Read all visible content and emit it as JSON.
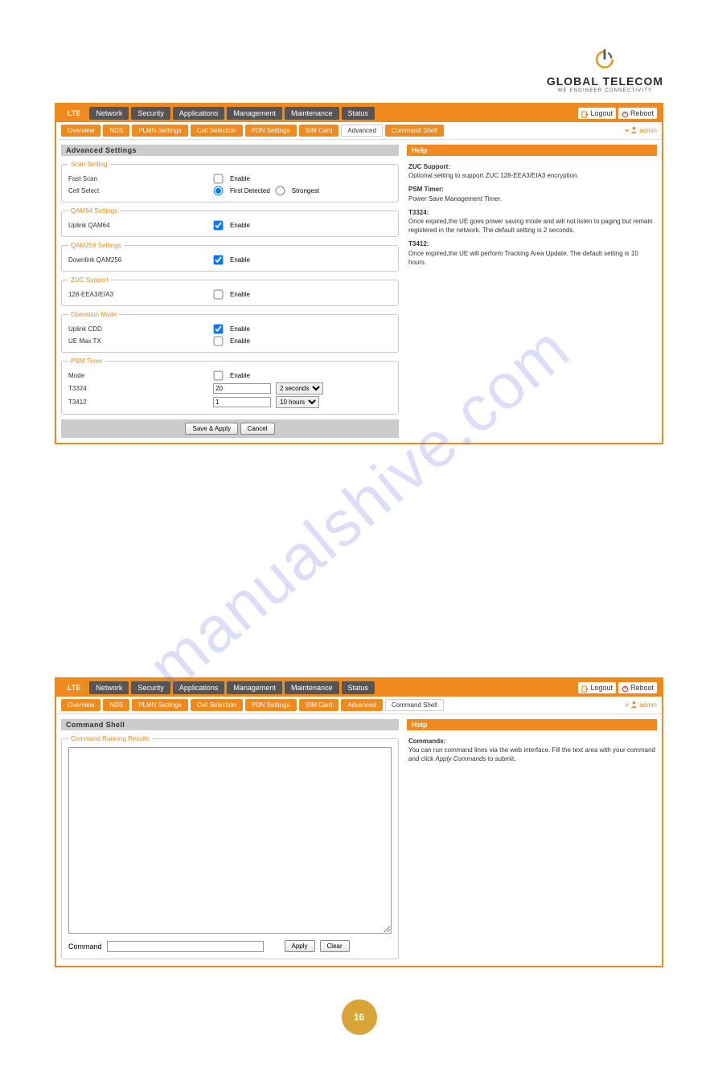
{
  "brand": {
    "name": "GLOBAL TELECOM",
    "tag": "WE ENGINEER CONNECTIVITY"
  },
  "watermark": "manualshive.com",
  "page_number": "16",
  "common": {
    "logout": "Logout",
    "reboot": "Reboot",
    "user": "admin",
    "plus": "+",
    "enable": "Enable",
    "first_detected": "First Detected",
    "strongest": "Strongest",
    "save_apply": "Save & Apply",
    "cancel": "Cancel",
    "apply": "Apply",
    "clear": "Clear"
  },
  "main_tabs": {
    "lte": "LTE",
    "network": "Network",
    "security": "Security",
    "applications": "Applications",
    "management": "Management",
    "maintenance": "Maintenance",
    "status": "Status"
  },
  "sub_tabs": {
    "overview": "Overview",
    "nds": "NDS",
    "plmn": "PLMN Settings",
    "cell": "Cell Selection",
    "pdn": "PDN Settings",
    "sim": "SIM Card",
    "advanced": "Advanced",
    "cmd": "Command Shell"
  },
  "panel1": {
    "title": "Advanced Settings",
    "help_title": "Help",
    "scan_legend": "Scan Setting",
    "fast_scan": "Fast Scan",
    "cell_select": "Cell Select",
    "qam64_legend": "QAM64 Settings",
    "uplink_qam64": "Uplink QAM64",
    "qam256_legend": "QAM256 Settings",
    "downlink_qam256": "Downlink QAM256",
    "zuc_legend": "ZUC Support",
    "zuc_label": "128-EEA3/EIA3",
    "op_legend": "Operation Mode",
    "uplink_cdd": "Uplink CDD",
    "ue_max_tx": "UE Max TX",
    "psm_legend": "PSM Timer",
    "mode": "Mode",
    "t3324": "T3324",
    "t3412": "T3412",
    "t3324_val": "20",
    "t3324_unit": "2 seconds",
    "t3412_val": "1",
    "t3412_unit": "10 hours",
    "help": {
      "zuc_h": "ZUC Support:",
      "zuc_t": "Optional setting to support ZUC 128-EEA3/EIA3 encryption.",
      "psm_h": "PSM Timer:",
      "psm_t": "Power Save Management Timer.",
      "t3324_h": "T3324:",
      "t3324_t": "Once expired,the UE goes power saving mode and will not listen to paging but remain registered in the network. The default setting is 2 seconds.",
      "t3412_h": "T3412:",
      "t3412_t": "Once expired,the UE will perform Tracking Area Update. The default setting is 10 hours."
    }
  },
  "panel2": {
    "title": "Command Shell",
    "help_title": "Help",
    "results_legend": "Command Running Results",
    "command_label": "Command",
    "help": {
      "cmd_h": "Commands:",
      "cmd_t1": "You can run command lines via the web interface. Fill the text area with your command and click ",
      "cmd_em": "Apply Commands",
      "cmd_t2": " to submit."
    }
  }
}
